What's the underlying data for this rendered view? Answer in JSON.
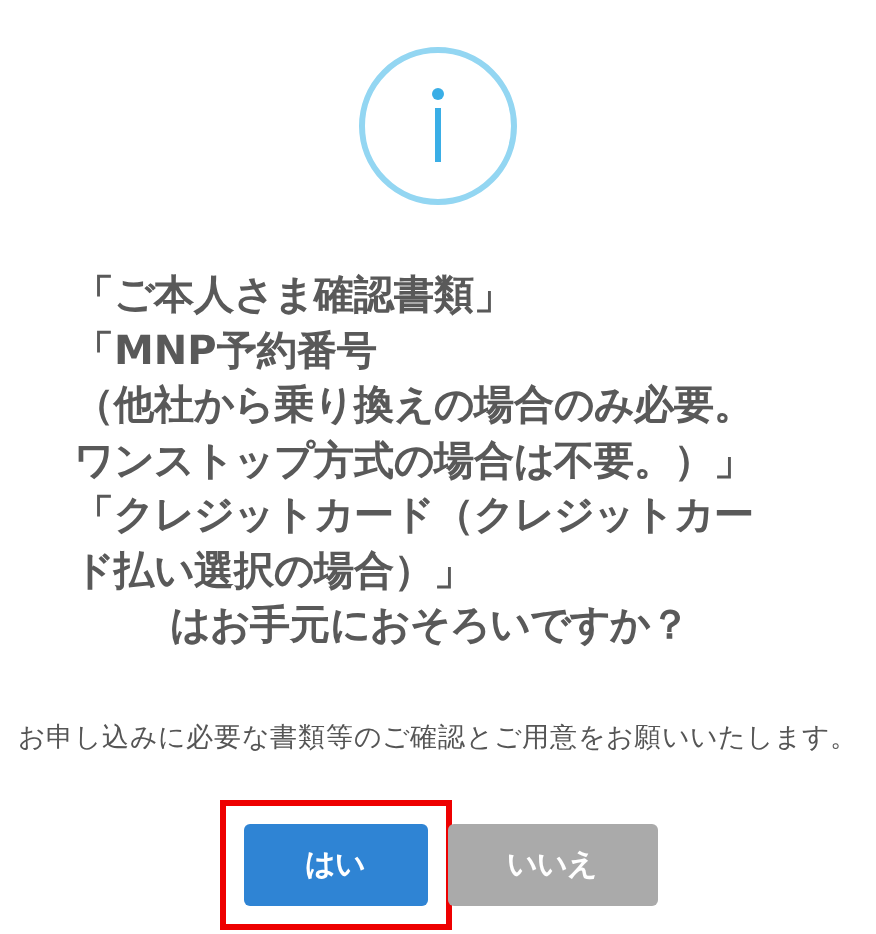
{
  "dialog": {
    "heading_lines": [
      "「ご本人さま確認書類」",
      "「MNP予約番号",
      "（他社から乗り換えの場合のみ必要。",
      "ワンストップ方式の場合は不要。）」",
      "「クレジットカード（クレジットカー",
      "ド払い選択の場合）」"
    ],
    "question": "はお手元におそろいですか？",
    "message": "お申し込みに必要な書類等のご確認とご用意をお願いいたします。",
    "buttons": [
      {
        "label": "はい",
        "kind": "confirm",
        "highlighted": true
      },
      {
        "label": "いいえ",
        "kind": "cancel",
        "highlighted": false
      }
    ]
  }
}
